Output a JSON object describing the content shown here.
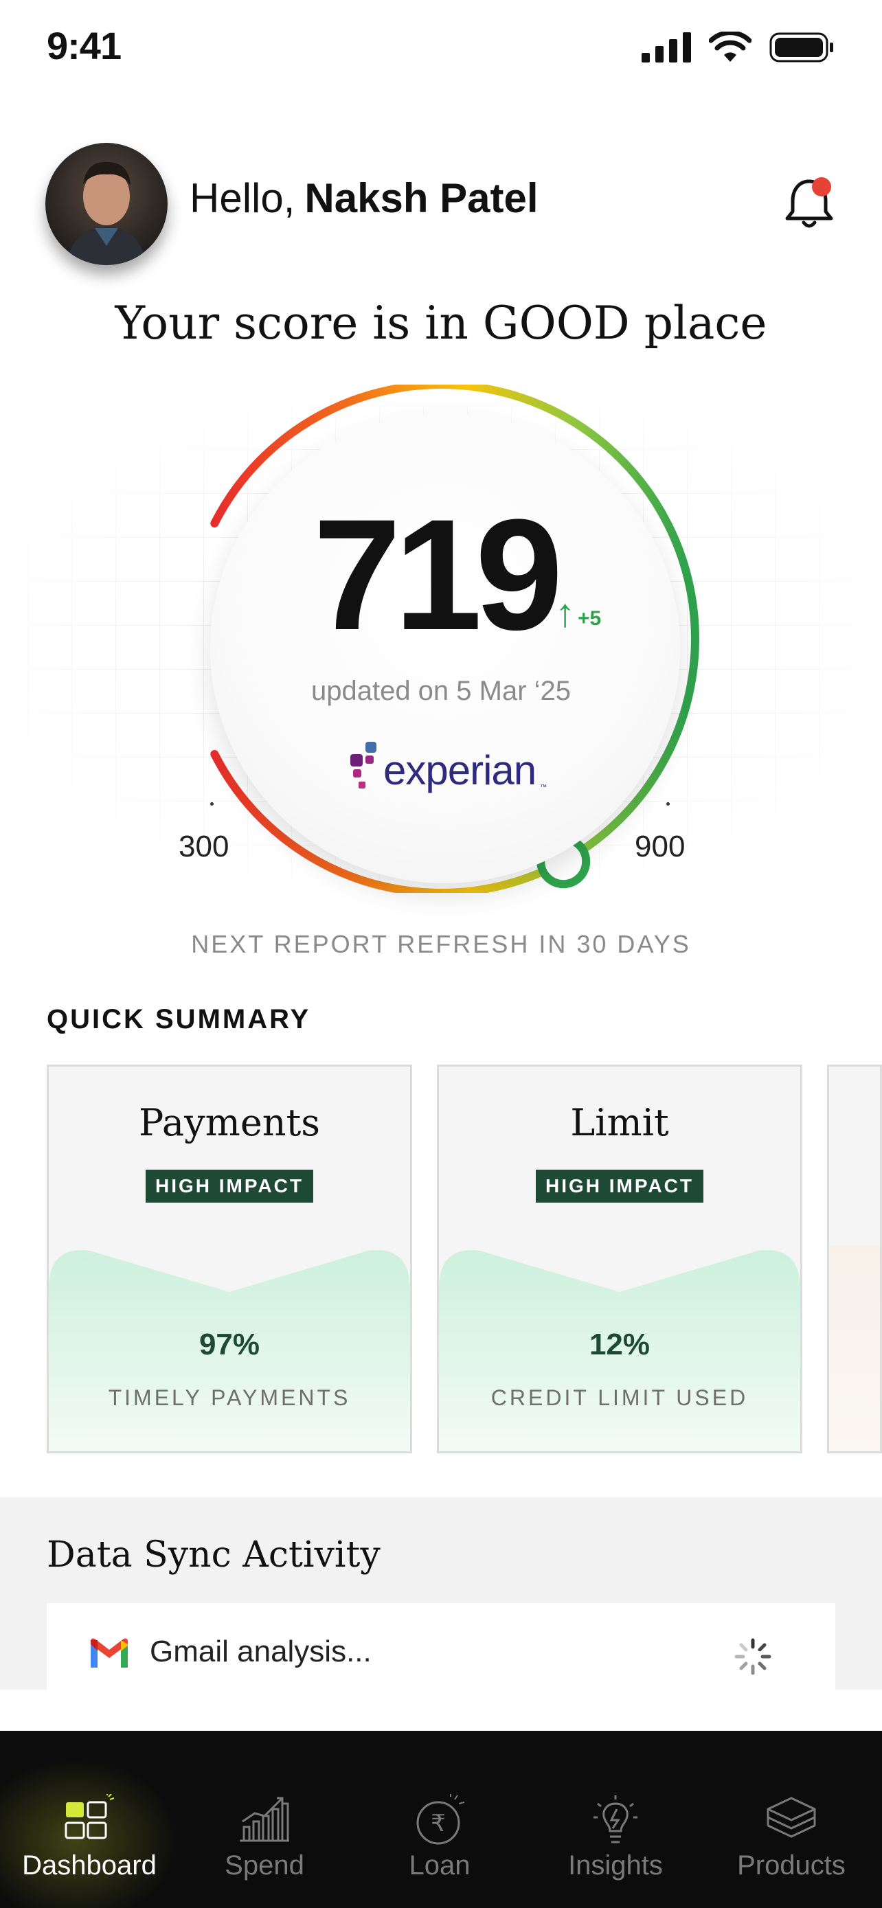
{
  "status_bar": {
    "time": "9:41"
  },
  "header": {
    "greeting": "Hello,",
    "user_name": "Naksh Patel",
    "has_notification": true
  },
  "headline": "Your score is in GOOD place",
  "score": {
    "value": "719",
    "delta": "+5",
    "updated": "updated on 5 Mar ‘25",
    "bureau": "experian",
    "range_min": "300",
    "range_max": "900",
    "score_fraction": 0.7
  },
  "refresh_note": "NEXT REPORT REFRESH IN 30 DAYS",
  "quick_summary": {
    "title": "QUICK SUMMARY",
    "cards": [
      {
        "title": "Payments",
        "badge": "HIGH IMPACT",
        "value": "97%",
        "label": "TIMELY PAYMENTS"
      },
      {
        "title": "Limit",
        "badge": "HIGH IMPACT",
        "value": "12%",
        "label": "CREDIT LIMIT USED"
      }
    ]
  },
  "data_sync": {
    "title": "Data Sync Activity",
    "items": [
      {
        "label": "Gmail analysis...",
        "icon": "gmail-icon",
        "status": "loading"
      }
    ]
  },
  "bottom_nav": {
    "items": [
      {
        "label": "Dashboard",
        "icon": "dashboard-icon",
        "active": true
      },
      {
        "label": "Spend",
        "icon": "spend-icon",
        "active": false
      },
      {
        "label": "Loan",
        "icon": "loan-icon",
        "active": false
      },
      {
        "label": "Insights",
        "icon": "insights-icon",
        "active": false
      },
      {
        "label": "Products",
        "icon": "products-icon",
        "active": false
      }
    ]
  },
  "colors": {
    "badge": "#1e4a35",
    "positive": "#2fa24c",
    "experian": "#2e2a7e",
    "nav_bg": "#0c0c0c"
  }
}
